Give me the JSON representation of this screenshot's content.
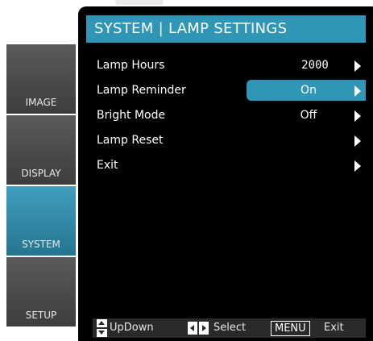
{
  "header": {
    "title": "SYSTEM | LAMP SETTINGS"
  },
  "sidebar": {
    "tabs": [
      {
        "label": "IMAGE",
        "active": false
      },
      {
        "label": "DISPLAY",
        "active": false
      },
      {
        "label": "SYSTEM",
        "active": true
      },
      {
        "label": "SETUP",
        "active": false
      }
    ]
  },
  "menu": {
    "items": [
      {
        "label": "Lamp Hours",
        "value": "2000",
        "selected": false
      },
      {
        "label": "Lamp Reminder",
        "value": "On",
        "selected": true
      },
      {
        "label": "Bright Mode",
        "value": "Off",
        "selected": false
      },
      {
        "label": "Lamp Reset",
        "value": "",
        "selected": false
      },
      {
        "label": "Exit",
        "value": "",
        "selected": false
      }
    ]
  },
  "footer": {
    "updown_label": "UpDown",
    "select_label": "Select",
    "menu_key": "MENU",
    "exit_label": "Exit"
  },
  "colors": {
    "accent": "#2f96b5",
    "background": "#000000",
    "sidebar_tab": "#4a4a4a",
    "text": "#ffffff"
  }
}
